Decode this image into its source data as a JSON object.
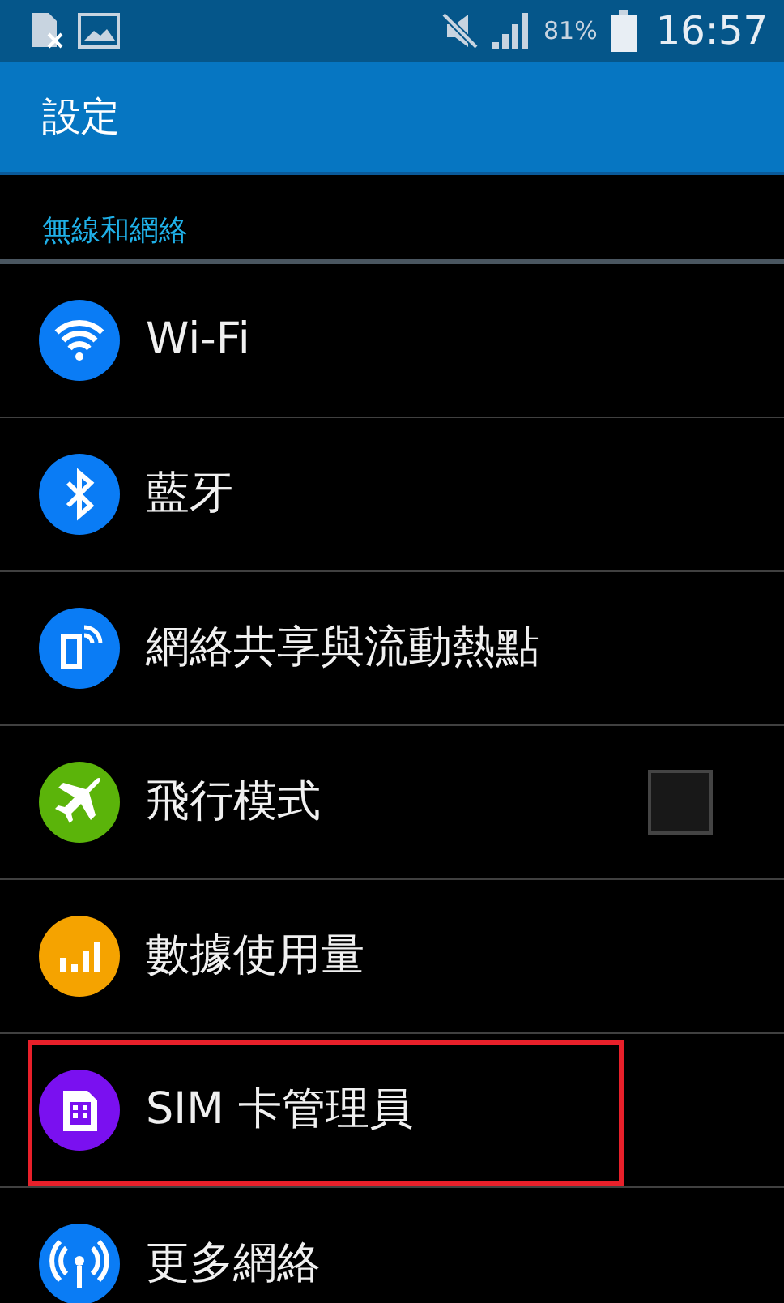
{
  "status_bar": {
    "battery_text": "81%",
    "time": "16:57"
  },
  "app_bar": {
    "title": "設定"
  },
  "section": {
    "title": "無線和網絡"
  },
  "items": [
    {
      "label": "Wi-Fi",
      "color": "#0a7cf5",
      "kind": "link",
      "highlighted": false
    },
    {
      "label": "藍牙",
      "color": "#0a7cf5",
      "kind": "link",
      "highlighted": false
    },
    {
      "label": "網絡共享與流動熱點",
      "color": "#0a7cf5",
      "kind": "link",
      "highlighted": false
    },
    {
      "label": "飛行模式",
      "color": "#5bb40a",
      "kind": "checkbox",
      "checked": false,
      "highlighted": false
    },
    {
      "label": "數據使用量",
      "color": "#f5a300",
      "kind": "link",
      "highlighted": false
    },
    {
      "label": "SIM 卡管理員",
      "color": "#7a10f0",
      "kind": "link",
      "highlighted": true
    },
    {
      "label": "更多網絡",
      "color": "#0a7cf5",
      "kind": "link",
      "highlighted": false
    }
  ]
}
